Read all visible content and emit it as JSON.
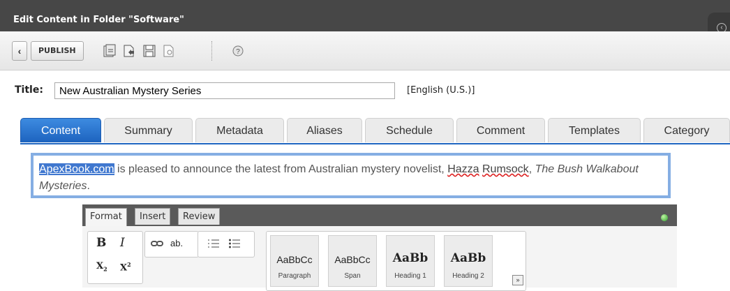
{
  "window": {
    "title": "Edit Content in Folder \"Software\""
  },
  "toolbar": {
    "back_icon": "chevron-left-icon",
    "publish_label": "PUBLISH",
    "icons": [
      "checkin-icon",
      "checkout-icon",
      "save-icon",
      "preview-icon",
      "help-icon"
    ]
  },
  "title_field": {
    "label": "Title:",
    "value": "New Australian Mystery Series",
    "language": "[English (U.S.)]"
  },
  "tabs": [
    {
      "label": "Content",
      "active": true
    },
    {
      "label": "Summary"
    },
    {
      "label": "Metadata"
    },
    {
      "label": "Aliases"
    },
    {
      "label": "Schedule"
    },
    {
      "label": "Comment"
    },
    {
      "label": "Templates"
    },
    {
      "label": "Category"
    }
  ],
  "editor": {
    "link_text": "ApexBook.com",
    "text_1": " is pleased to announce the latest from Australian mystery novelist, ",
    "name_first": "Hazza",
    "name_last": "Rumsock",
    "text_2": ", ",
    "title_italic": "The Bush Walkabout Mysteries",
    "text_3": "."
  },
  "ribbon": {
    "tabs": [
      {
        "label": "Format",
        "active": true
      },
      {
        "label": "Insert"
      },
      {
        "label": "Review"
      }
    ],
    "format": {
      "bold": "B",
      "italic": "I",
      "subscript": "X",
      "subscript_mark": "2",
      "superscript": "X",
      "superscript_mark": "2"
    },
    "link_label": "ab.",
    "styles": [
      {
        "sample": "AaBbCc",
        "label": "Paragraph"
      },
      {
        "sample": "AaBbCc",
        "label": "Span"
      },
      {
        "sample": "AaBb",
        "label": "Heading 1"
      },
      {
        "sample": "AaBb",
        "label": "Heading 2"
      }
    ],
    "expand_icon": "expand-down-icon"
  },
  "colors": {
    "accent": "#1d63bf",
    "titlebar": "#474747",
    "selection": "#3f77cf"
  }
}
